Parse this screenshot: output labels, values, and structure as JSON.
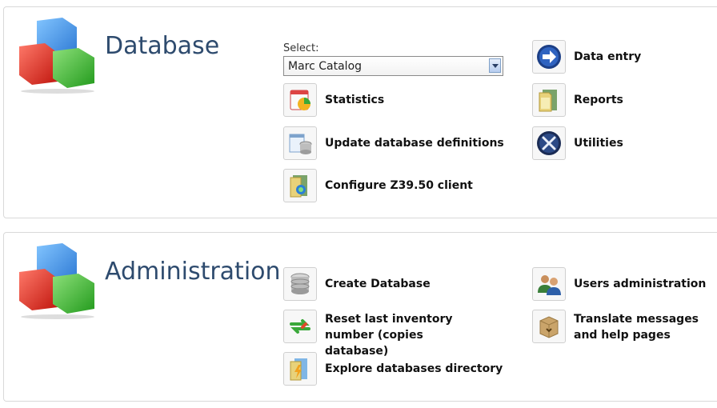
{
  "database": {
    "title": "Database",
    "select_label": "Select:",
    "select_value": "Marc Catalog",
    "items": [
      {
        "label": "Data entry",
        "icon": "data-entry-arrow-icon"
      },
      {
        "label": "Statistics",
        "icon": "statistics-chart-icon"
      },
      {
        "label": "Reports",
        "icon": "reports-folder-icon"
      },
      {
        "label": "Update database definitions",
        "icon": "update-definitions-icon"
      },
      {
        "label": "Utilities",
        "icon": "utilities-tools-icon"
      },
      {
        "label": "Configure Z39.50 client",
        "icon": "z3950-client-icon"
      }
    ]
  },
  "administration": {
    "title": "Administration",
    "items": [
      {
        "label": "Create Database",
        "icon": "create-database-icon"
      },
      {
        "label": "Users administration",
        "icon": "users-icon"
      },
      {
        "label": "Reset last inventory number (copies database)",
        "icon": "reset-refresh-icon"
      },
      {
        "label": "Translate messages and help pages",
        "icon": "translate-box-icon"
      },
      {
        "label": "Explore databases directory",
        "icon": "explore-folder-icon"
      }
    ]
  },
  "colors": {
    "title": "#2e4b6e",
    "cube_blue": "#3f8fe6",
    "cube_red": "#e23a2a",
    "cube_green": "#3fb53a"
  }
}
